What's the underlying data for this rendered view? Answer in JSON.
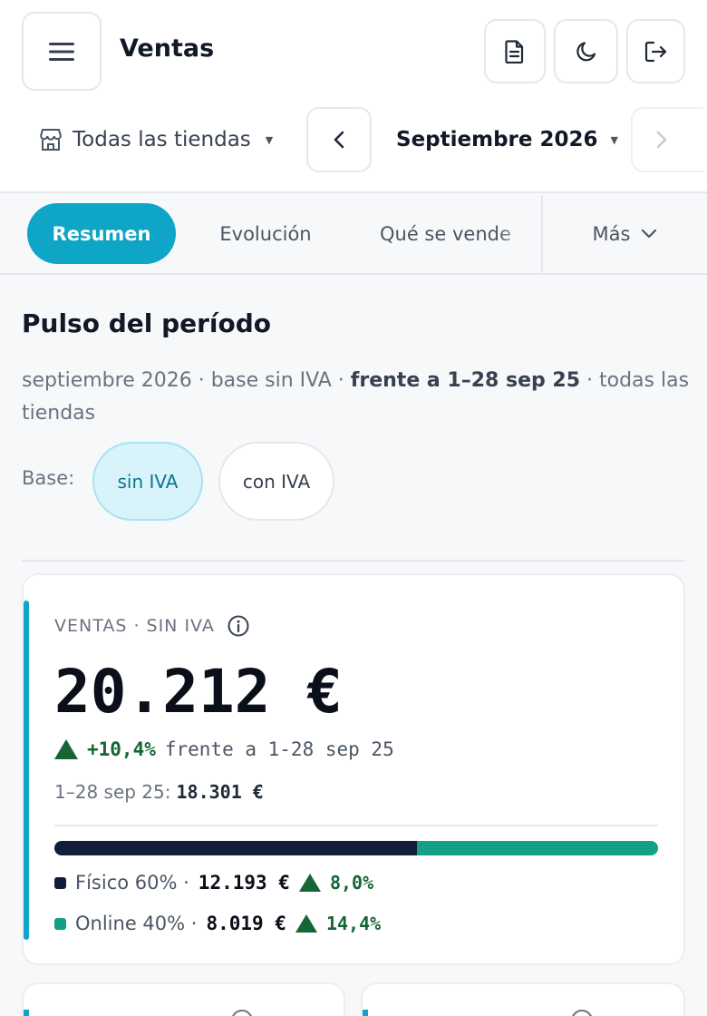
{
  "header": {
    "title": "Ventas",
    "store": "Todas las tiendas",
    "period": "Septiembre 2026",
    "actions": [
      "document-icon",
      "moon-icon",
      "logout-icon"
    ]
  },
  "tabs": {
    "items": [
      "Resumen",
      "Evolución",
      "Qué se vende"
    ],
    "active": "Resumen",
    "more": "Más"
  },
  "section": {
    "title": "Pulso del período",
    "subtitle_part1": "septiembre 2026 · base sin IVA · ",
    "subtitle_bold": "frente a 1–28 sep 25",
    "subtitle_part2": " · todas las tiendas"
  },
  "base": {
    "label": "Base:",
    "options": [
      "sin IVA",
      "con IVA"
    ],
    "selected": "sin IVA"
  },
  "sales_card": {
    "label": "VENTAS · SIN IVA",
    "value": "20.212 €",
    "delta": "+10,4%",
    "delta_text": "frente a 1-28 sep 25",
    "prev_label": "1–28 sep 25:",
    "prev_value": "18.301 €",
    "split": [
      {
        "label": "Físico 60% ·",
        "share": 60,
        "value": "12.193 €",
        "delta": "8,0%",
        "color": "#111d3a"
      },
      {
        "label": "Online 40% ·",
        "share": 40,
        "value": "8.019 €",
        "delta": "14,4%",
        "color": "#14a085"
      }
    ]
  },
  "colors": {
    "accent": "#0ea5c6",
    "positive": "#166534"
  }
}
